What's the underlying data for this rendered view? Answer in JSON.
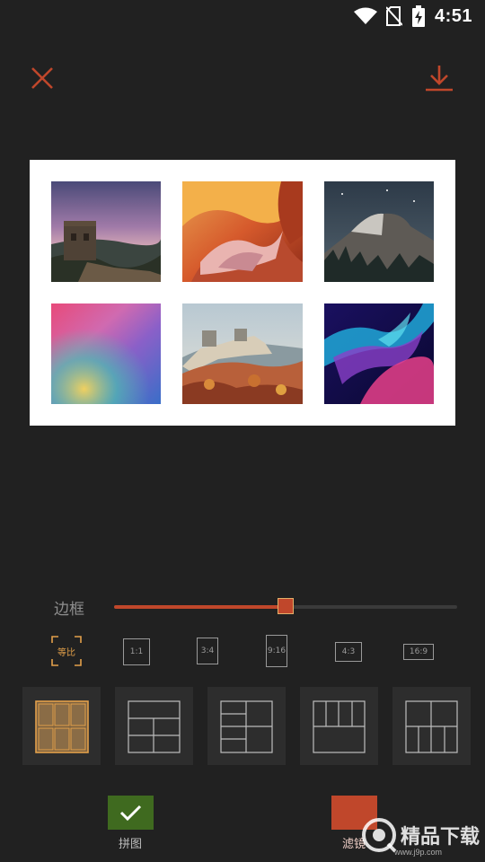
{
  "status_bar": {
    "time": "4:51",
    "icons": [
      "wifi-icon",
      "no-sim-icon",
      "battery-charging-icon"
    ]
  },
  "toolbar": {
    "close_icon": "close-icon",
    "download_icon": "download-icon",
    "accent_color": "#c0472b"
  },
  "canvas": {
    "background": "#ffffff",
    "photos": [
      {
        "name": "great-wall-night-photo"
      },
      {
        "name": "antelope-canyon-photo"
      },
      {
        "name": "half-dome-night-photo"
      },
      {
        "name": "gradient-wallpaper-photo"
      },
      {
        "name": "great-wall-autumn-photo"
      },
      {
        "name": "aurora-abstract-photo"
      }
    ]
  },
  "border": {
    "label": "边框",
    "value": 0.5
  },
  "ratios": [
    {
      "label": "等比",
      "selected": true
    },
    {
      "label": "1:1",
      "selected": false
    },
    {
      "label": "3:4",
      "selected": false
    },
    {
      "label": "9:16",
      "selected": false
    },
    {
      "label": "4:3",
      "selected": false
    },
    {
      "label": "16:9",
      "selected": false
    }
  ],
  "layouts": [
    {
      "name": "grid-2x3",
      "selected": true
    },
    {
      "name": "grid-3x2",
      "selected": false
    },
    {
      "name": "grid-mixed-left",
      "selected": false
    },
    {
      "name": "grid-mixed-top",
      "selected": false
    },
    {
      "name": "grid-mixed-bottom",
      "selected": false
    }
  ],
  "bottom": {
    "collage_label": "拼图",
    "filter_label": "滤镜"
  },
  "watermark": {
    "text": "精品下载",
    "sub": "www.j9p.com"
  }
}
